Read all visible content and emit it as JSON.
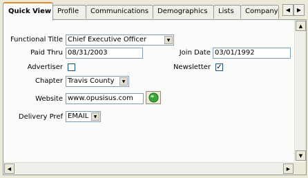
{
  "tabs": [
    {
      "label": "Quick View",
      "active": true
    },
    {
      "label": "Profile"
    },
    {
      "label": "Communications"
    },
    {
      "label": "Demographics"
    },
    {
      "label": "Lists"
    },
    {
      "label": "Company"
    }
  ],
  "tab_scroll": {
    "left_icon": "arrow-left-icon",
    "right_icon": "arrow-right-icon"
  },
  "form": {
    "functional_title": {
      "label": "Functional Title",
      "value": "Chief Executive Officer"
    },
    "paid_thru": {
      "label": "Paid Thru",
      "value": "08/31/2003"
    },
    "join_date": {
      "label": "Join Date",
      "value": "03/01/1992"
    },
    "advertiser": {
      "label": "Advertiser",
      "checked": false
    },
    "newsletter": {
      "label": "Newsletter",
      "checked": true
    },
    "chapter": {
      "label": "Chapter",
      "value": "Travis County"
    },
    "website": {
      "label": "Website",
      "value": "www.opusisus.com",
      "button_icon": "globe-icon"
    },
    "delivery_pref": {
      "label": "Delivery Pref",
      "value": "EMAIL"
    }
  },
  "colors": {
    "accent": "#e68b2c",
    "field_border": "#7f9db9",
    "window_bg": "#ece9d8"
  }
}
